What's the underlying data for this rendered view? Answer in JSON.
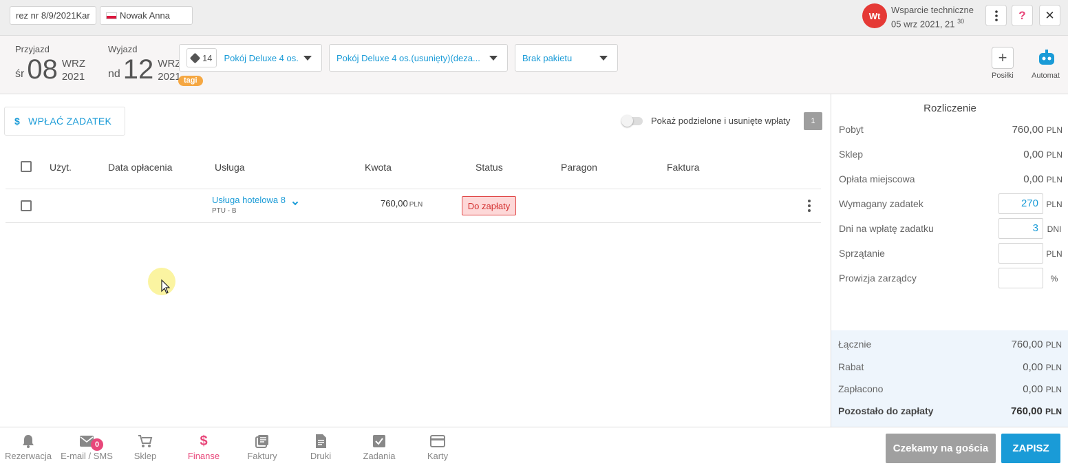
{
  "topbar": {
    "reservation_chip": "rez nr 8/9/2021Kar",
    "guest_chip": "Nowak Anna",
    "avatar_initials": "Wt",
    "user_name": "Wsparcie techniczne",
    "user_date": "05 wrz 2021, 21",
    "user_time_minutes": "30"
  },
  "reservation": {
    "arrival_label": "Przyjazd",
    "arrival_dow": "śr",
    "arrival_day": "08",
    "arrival_month": "WRZ",
    "arrival_year": "2021",
    "departure_label": "Wyjazd",
    "departure_dow": "nd",
    "departure_day": "12",
    "departure_month": "WRZ",
    "departure_year": "2021",
    "room_number": "14",
    "room_type": "Pokój Deluxe 4 os.",
    "room_name": "Pokój Deluxe 4 os.(usunięty)(deza...",
    "package": "Brak pakietu",
    "tags_badge": "tagi",
    "meals_label": "Posiłki",
    "automat_label": "Automat"
  },
  "finance": {
    "deposit_button": "WPŁAĆ ZADATEK",
    "show_split_label": "Pokaż podzielone i usunięte wpłaty",
    "count_badge": "1",
    "columns": [
      "Użyt.",
      "Data opłacenia",
      "Usługa",
      "Kwota",
      "Status",
      "Paragon",
      "Faktura"
    ],
    "rows": [
      {
        "service": "Usługa hotelowa 8",
        "service_sub": "PTU - B",
        "amount": "760,00",
        "currency": "PLN",
        "status": "Do zapłaty"
      }
    ]
  },
  "settlement": {
    "title": "Rozliczenie",
    "stay_label": "Pobyt",
    "stay_value": "760,00",
    "stay_unit": "PLN",
    "shop_label": "Sklep",
    "shop_value": "0,00",
    "shop_unit": "PLN",
    "fee_label": "Opłata miejscowa",
    "fee_value": "0,00",
    "fee_unit": "PLN",
    "deposit_label": "Wymagany zadatek",
    "deposit_value": "270",
    "deposit_unit": "PLN",
    "days_label": "Dni na wpłatę zadatku",
    "days_value": "3",
    "days_unit": "DNI",
    "cleaning_label": "Sprzątanie",
    "cleaning_value": "",
    "cleaning_unit": "PLN",
    "commission_label": "Prowizja zarządcy",
    "commission_value": "",
    "commission_unit": "%",
    "total_label": "Łącznie",
    "total_value": "760,00",
    "total_unit": "PLN",
    "discount_label": "Rabat",
    "discount_value": "0,00",
    "discount_unit": "PLN",
    "paid_label": "Zapłacono",
    "paid_value": "0,00",
    "paid_unit": "PLN",
    "remaining_label": "Pozostało do zapłaty",
    "remaining_value": "760,00",
    "remaining_unit": "PLN"
  },
  "bottom_nav": {
    "items": [
      {
        "label": "Rezerwacja",
        "icon": "bell-icon"
      },
      {
        "label": "E-mail / SMS",
        "icon": "mail-icon",
        "badge": "0"
      },
      {
        "label": "Sklep",
        "icon": "cart-icon"
      },
      {
        "label": "Finanse",
        "icon": "dollar-icon"
      },
      {
        "label": "Faktury",
        "icon": "invoices-icon"
      },
      {
        "label": "Druki",
        "icon": "document-icon"
      },
      {
        "label": "Zadania",
        "icon": "checkbox-icon"
      },
      {
        "label": "Karty",
        "icon": "card-icon"
      }
    ],
    "wait_button": "Czekamy na gościa",
    "save_button": "ZAPISZ"
  },
  "colors": {
    "accent": "#1a9bd7",
    "active_nav": "#e8477a",
    "status_unpaid_bg": "#fdd8d8",
    "status_unpaid_text": "#d32f2f",
    "avatar": "#e53935",
    "tags": "#f5a742"
  }
}
